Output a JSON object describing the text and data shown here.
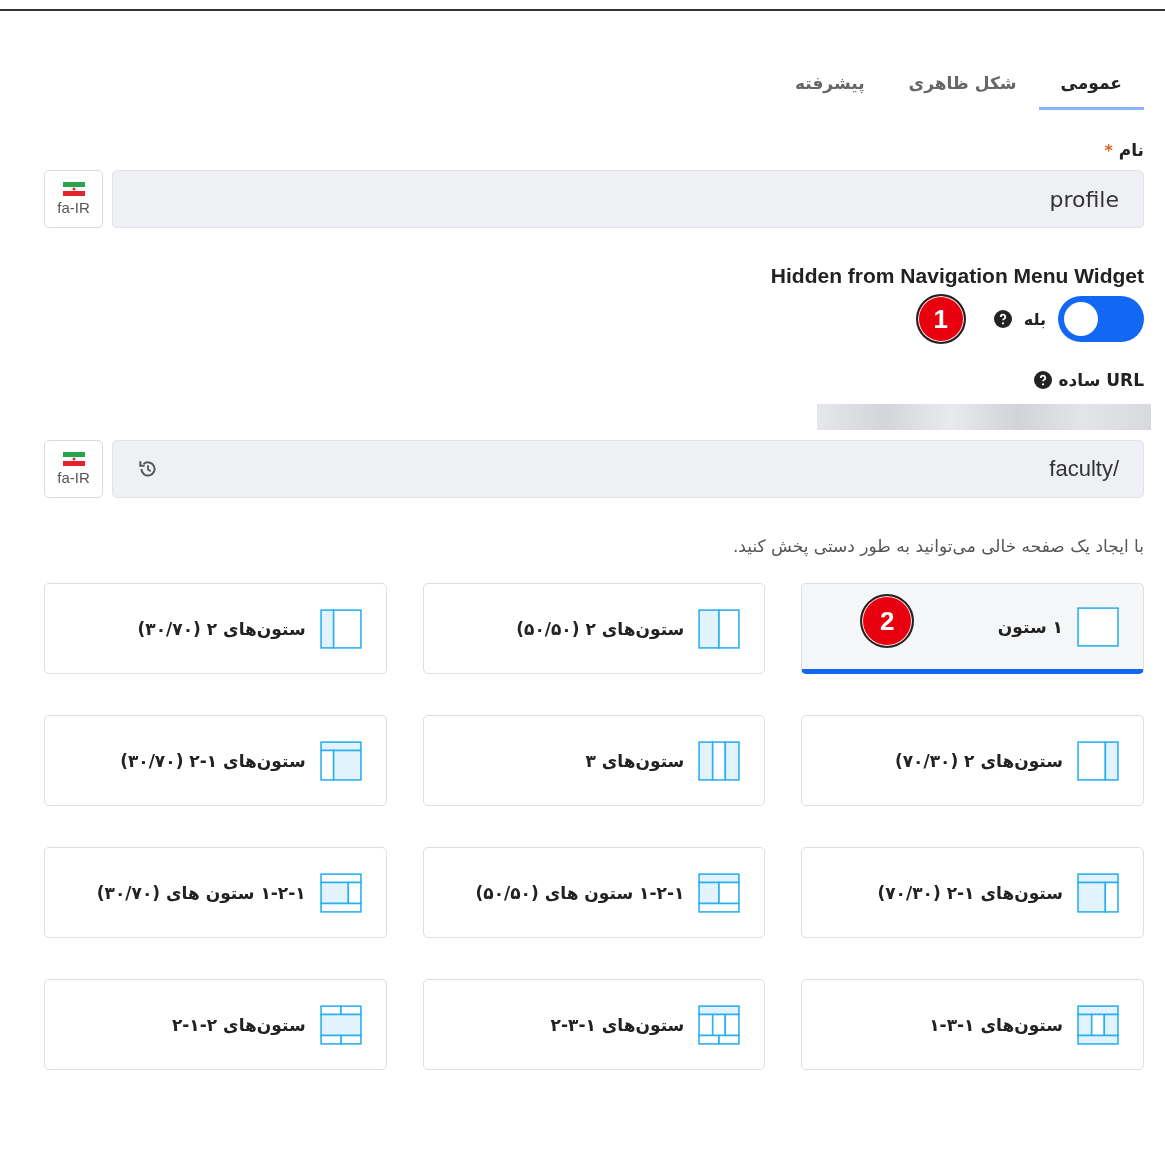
{
  "tabs": [
    {
      "label": "عمومی",
      "selected": true
    },
    {
      "label": "شکل ظاهری",
      "selected": false
    },
    {
      "label": "پیشرفته",
      "selected": false
    }
  ],
  "name_field": {
    "label": "نام",
    "required_mark": "*",
    "value": "profile",
    "locale": "fa-IR"
  },
  "nav_hidden": {
    "label": "Hidden from Navigation Menu Widget",
    "toggle_label": "بله",
    "on": true,
    "badge": "1"
  },
  "url_field": {
    "label": "URL ساده",
    "value": "faculty/",
    "locale": "fa-IR"
  },
  "hint": "با ایجاد یک صفحه خالی می‌توانید به طور دستی پخش کنید.",
  "layouts": [
    {
      "label": "۱ ستون",
      "kind": "one",
      "selected": true,
      "badge": "2"
    },
    {
      "label": "ستون‌های ۲ (۵۰/۵۰)",
      "kind": "two5050",
      "selected": false
    },
    {
      "label": "ستون‌های ۲ (۳۰/۷۰)",
      "kind": "two3070",
      "selected": false
    },
    {
      "label": "ستون‌های ۲ (۷۰/۳۰)",
      "kind": "two7030",
      "selected": false
    },
    {
      "label": "ستون‌های ۳",
      "kind": "three",
      "selected": false
    },
    {
      "label": "ستون‌های ۱-۲ (۳۰/۷۰)",
      "kind": "top3070",
      "selected": false
    },
    {
      "label": "ستون‌های ۱-۲ (۷۰/۳۰)",
      "kind": "top7030",
      "selected": false
    },
    {
      "label": "۱-۲-۱ ستون های (۵۰/۵۰)",
      "kind": "sandwich5050",
      "selected": false
    },
    {
      "label": "۱-۲-۱ ستون های (۳۰/۷۰)",
      "kind": "sandwich3070",
      "selected": false
    },
    {
      "label": "ستون‌های ۱-۳-۱",
      "kind": "sandwich3",
      "selected": false
    },
    {
      "label": "ستون‌های ۱-۳-۲",
      "kind": "sandwich32",
      "selected": false
    },
    {
      "label": "ستون‌های ۲-۱-۲",
      "kind": "split212",
      "selected": false
    }
  ]
}
